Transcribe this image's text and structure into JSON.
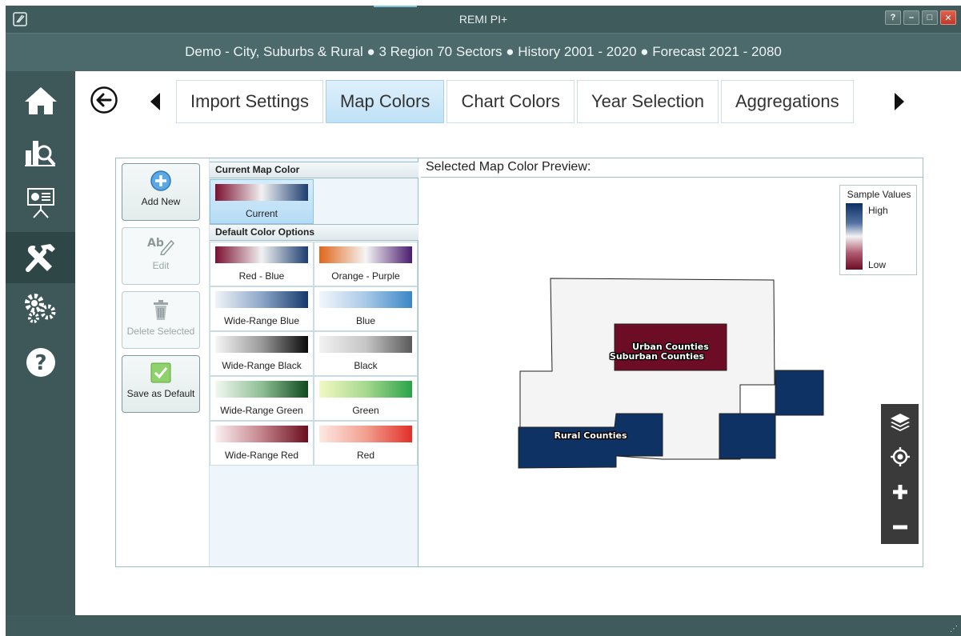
{
  "window": {
    "title": "REMI PI+",
    "subtitle": "Demo - City, Suburbs & Rural ● 3 Region 70 Sectors ● History 2001 - 2020 ● Forecast 2021 - 2080",
    "buttons": [
      "?",
      "–",
      "□",
      "✕"
    ]
  },
  "sidebar": {
    "items": [
      {
        "icon": "home-icon"
      },
      {
        "icon": "chart-search-icon"
      },
      {
        "icon": "presentation-icon"
      },
      {
        "icon": "tools-icon",
        "active": true
      },
      {
        "icon": "gears-icon"
      },
      {
        "icon": "help-icon"
      }
    ]
  },
  "tabs": {
    "items": [
      {
        "label": "Import Settings"
      },
      {
        "label": "Map Colors",
        "active": true
      },
      {
        "label": "Chart Colors"
      },
      {
        "label": "Year Selection"
      },
      {
        "label": "Aggregations"
      }
    ]
  },
  "actions": {
    "add_new": "Add New",
    "edit": "Edit",
    "delete": "Delete Selected",
    "save_default": "Save as Default"
  },
  "color_list": {
    "current_header": "Current Map Color",
    "current_label": "Current",
    "default_header": "Default Color Options",
    "options": [
      {
        "label": "Red - Blue",
        "from": "#7a1030",
        "mid": "#f2f2f2",
        "to": "#1c3d70"
      },
      {
        "label": "Orange - Purple",
        "from": "#e0661a",
        "mid": "#f5f5f5",
        "to": "#4a1c6e"
      },
      {
        "label": "Wide-Range Blue",
        "from": "#f0f4f8",
        "mid": "#8ea7c9",
        "to": "#15386b"
      },
      {
        "label": "Blue",
        "from": "#f3f7fb",
        "mid": "#a9c9e8",
        "to": "#3b86c6"
      },
      {
        "label": "Wide-Range Black",
        "from": "#f6f6f6",
        "mid": "#9a9a9a",
        "to": "#0a0a0a"
      },
      {
        "label": "Black",
        "from": "#f2f2f2",
        "mid": "#c6c6c6",
        "to": "#5a5a5a"
      },
      {
        "label": "Wide-Range Green",
        "from": "#f3f8f3",
        "mid": "#8fbf95",
        "to": "#0f4a1e"
      },
      {
        "label": "Green",
        "from": "#f3f9c4",
        "mid": "#a7d98f",
        "to": "#2aa34a"
      },
      {
        "label": "Wide-Range Red",
        "from": "#fbf1f1",
        "mid": "#c4848c",
        "to": "#6a0d1e"
      },
      {
        "label": "Red",
        "from": "#fde9e4",
        "mid": "#f2a090",
        "to": "#e0302a"
      }
    ],
    "current": {
      "from": "#7a1030",
      "mid": "#f2f2f2",
      "to": "#1c3d70"
    }
  },
  "preview": {
    "title": "Selected Map Color Preview:",
    "legend_title": "Sample Values",
    "legend_high": "High",
    "legend_low": "Low",
    "labels": {
      "urban": "Urban Counties",
      "suburban": "Suburban Counties",
      "rural": "Rural Counties"
    },
    "colors": {
      "urban": "#6c0c25",
      "suburban": "#f4f4f4",
      "rural": "#0e3263"
    }
  },
  "map_tools": [
    "layers-icon",
    "locate-icon",
    "zoom-in-icon",
    "zoom-out-icon"
  ]
}
